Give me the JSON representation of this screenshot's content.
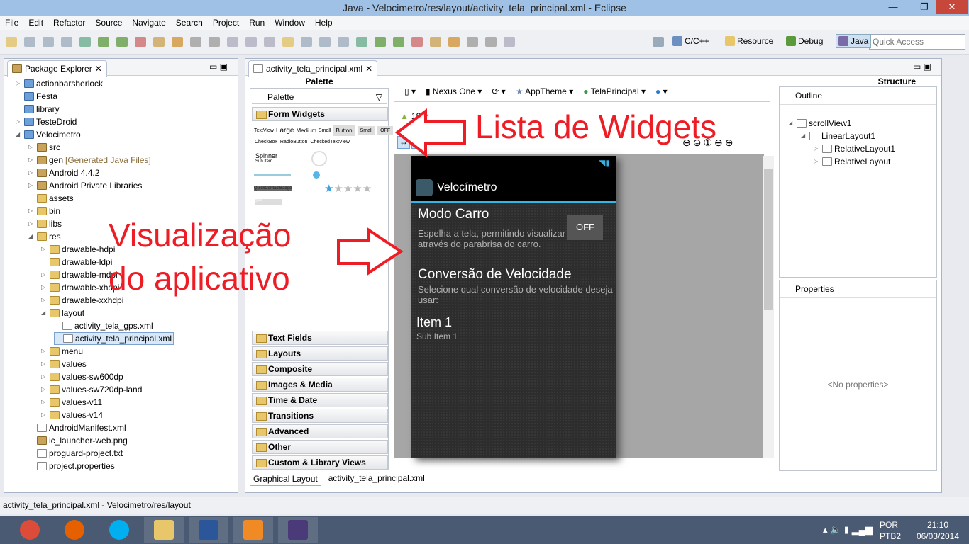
{
  "window": {
    "title": "Java - Velocimetro/res/layout/activity_tela_principal.xml - Eclipse",
    "min": "—",
    "max": "❐",
    "close": "✕"
  },
  "menu": [
    "File",
    "Edit",
    "Refactor",
    "Source",
    "Navigate",
    "Search",
    "Project",
    "Run",
    "Window",
    "Help"
  ],
  "perspectives": [
    {
      "label": "C/C++",
      "color": "#6a8fc0"
    },
    {
      "label": "Resource",
      "color": "#e8c66a"
    },
    {
      "label": "Debug",
      "color": "#5a9a3a"
    },
    {
      "label": "Java",
      "color": "#7a6aa8"
    }
  ],
  "quick_access": {
    "placeholder": "Quick Access"
  },
  "package_explorer": {
    "title": "Package Explorer",
    "items": [
      {
        "label": "actionbarsherlock",
        "level": 0,
        "icon": "project",
        "tw": "▷"
      },
      {
        "label": "Festa",
        "level": 0,
        "icon": "project",
        "tw": ""
      },
      {
        "label": "library",
        "level": 0,
        "icon": "project",
        "tw": ""
      },
      {
        "label": "TesteDroid",
        "level": 0,
        "icon": "project",
        "tw": "▷"
      },
      {
        "label": "Velocimetro",
        "level": 0,
        "icon": "project",
        "tw": "◢"
      },
      {
        "label": "src",
        "level": 1,
        "icon": "package",
        "tw": "▷"
      },
      {
        "label": "gen",
        "suffix": "[Generated Java Files]",
        "level": 1,
        "icon": "package",
        "tw": "▷"
      },
      {
        "label": "Android 4.4.2",
        "level": 1,
        "icon": "library",
        "tw": "▷"
      },
      {
        "label": "Android Private Libraries",
        "level": 1,
        "icon": "library",
        "tw": "▷"
      },
      {
        "label": "assets",
        "level": 1,
        "icon": "folder",
        "tw": ""
      },
      {
        "label": "bin",
        "level": 1,
        "icon": "folder",
        "tw": "▷"
      },
      {
        "label": "libs",
        "level": 1,
        "icon": "folder",
        "tw": "▷"
      },
      {
        "label": "res",
        "level": 1,
        "icon": "folder",
        "tw": "◢"
      },
      {
        "label": "drawable-hdpi",
        "level": 2,
        "icon": "folder",
        "tw": "▷"
      },
      {
        "label": "drawable-ldpi",
        "level": 2,
        "icon": "folder",
        "tw": ""
      },
      {
        "label": "drawable-mdpi",
        "level": 2,
        "icon": "folder",
        "tw": "▷"
      },
      {
        "label": "drawable-xhdpi",
        "level": 2,
        "icon": "folder",
        "tw": "▷"
      },
      {
        "label": "drawable-xxhdpi",
        "level": 2,
        "icon": "folder",
        "tw": "▷"
      },
      {
        "label": "layout",
        "level": 2,
        "icon": "folder",
        "tw": "◢"
      },
      {
        "label": "activity_tela_gps.xml",
        "level": 3,
        "icon": "file",
        "tw": ""
      },
      {
        "label": "activity_tela_principal.xml",
        "level": 3,
        "icon": "file",
        "tw": "",
        "selected": true
      },
      {
        "label": "menu",
        "level": 2,
        "icon": "folder",
        "tw": "▷"
      },
      {
        "label": "values",
        "level": 2,
        "icon": "folder",
        "tw": "▷"
      },
      {
        "label": "values-sw600dp",
        "level": 2,
        "icon": "folder",
        "tw": "▷"
      },
      {
        "label": "values-sw720dp-land",
        "level": 2,
        "icon": "folder",
        "tw": "▷"
      },
      {
        "label": "values-v11",
        "level": 2,
        "icon": "folder",
        "tw": "▷"
      },
      {
        "label": "values-v14",
        "level": 2,
        "icon": "folder",
        "tw": "▷"
      },
      {
        "label": "AndroidManifest.xml",
        "level": 1,
        "icon": "file",
        "tw": ""
      },
      {
        "label": "ic_launcher-web.png",
        "level": 1,
        "icon": "image",
        "tw": ""
      },
      {
        "label": "proguard-project.txt",
        "level": 1,
        "icon": "file",
        "tw": ""
      },
      {
        "label": "project.properties",
        "level": 1,
        "icon": "file",
        "tw": ""
      }
    ]
  },
  "editor": {
    "tab": "activity_tela_principal.xml",
    "bottom_tabs": [
      "Graphical Layout",
      "activity_tela_principal.xml"
    ]
  },
  "palette": {
    "header": "Palette",
    "dropdown": "Palette",
    "open_category": "Form Widgets",
    "widgets": {
      "textview": "TextView",
      "large": "Large",
      "medium": "Medium",
      "small": "Small",
      "button": "Button",
      "small_button": "Small",
      "toggle": "OFF",
      "checkbox": "CheckBox",
      "radio": "RadioButton",
      "checked": "CheckedTextView",
      "spinner": "Spinner",
      "sub_item": "Sub Item",
      "qcb": "QuickContactBadge",
      "switch": "OFF"
    },
    "categories": [
      "Text Fields",
      "Layouts",
      "Composite",
      "Images & Media",
      "Time & Date",
      "Transitions",
      "Advanced",
      "Other",
      "Custom & Library Views"
    ]
  },
  "layout_toolbar": {
    "device": "Nexus One",
    "theme": "AppTheme",
    "activity": "TelaPrincipal",
    "api": "19"
  },
  "preview": {
    "app_title": "Velocímetro",
    "modo_title": "Modo Carro",
    "modo_desc": "Espelha a tela, permitindo visualizar através do parabrisa do carro.",
    "toggle": "OFF",
    "conv_title": "Conversão de Velocidade",
    "conv_desc": "Selecione qual conversão de velocidade deseja usar:",
    "item": "Item 1",
    "sub_item": "Sub Item 1"
  },
  "structure": {
    "header": "Structure",
    "outline_title": "Outline",
    "tree": [
      {
        "label": "scrollView1",
        "level": 0
      },
      {
        "label": "LinearLayout1",
        "level": 1
      },
      {
        "label": "RelativeLayout1",
        "level": 2
      },
      {
        "label": "RelativeLayout",
        "level": 2
      }
    ],
    "properties_title": "Properties",
    "no_properties": "<No properties>"
  },
  "annotations": {
    "widgets": "Lista de Widgets",
    "preview_line1": "Visualização",
    "preview_line2": "do aplicativo"
  },
  "status_bar": "activity_tela_principal.xml - Velocimetro/res/layout",
  "taskbar": {
    "lang1": "POR",
    "lang2": "PTB2",
    "time": "21:10",
    "date": "06/03/2014",
    "apps": [
      {
        "name": "chrome",
        "color": "#dd4b39"
      },
      {
        "name": "firefox",
        "color": "#e66000"
      },
      {
        "name": "skype",
        "color": "#00aff0"
      },
      {
        "name": "file-explorer",
        "color": "#e8c66a"
      },
      {
        "name": "word",
        "color": "#2b579a"
      },
      {
        "name": "media-player",
        "color": "#f08a24"
      },
      {
        "name": "eclipse-javaee",
        "color": "#4b3a7a"
      }
    ]
  }
}
